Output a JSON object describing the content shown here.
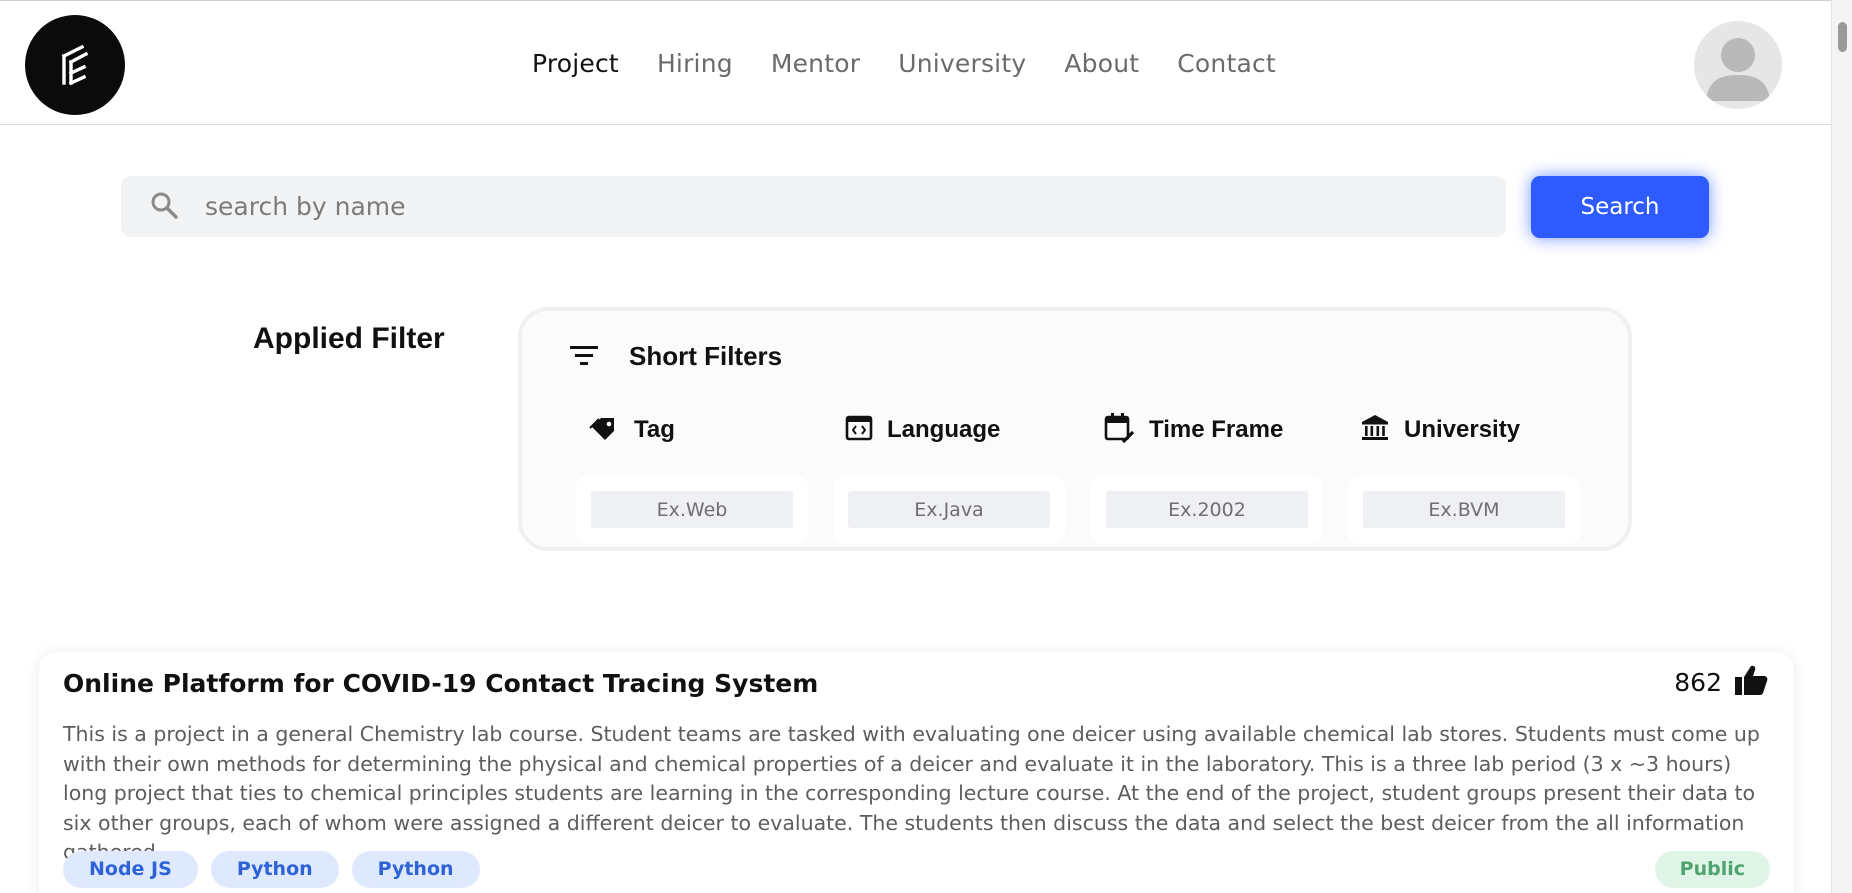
{
  "header": {
    "logo_icon": "brand-logo-icon",
    "nav": [
      {
        "label": "Project",
        "active": true
      },
      {
        "label": "Hiring",
        "active": false
      },
      {
        "label": "Mentor",
        "active": false
      },
      {
        "label": "University",
        "active": false
      },
      {
        "label": "About",
        "active": false
      },
      {
        "label": "Contact",
        "active": false
      }
    ],
    "avatar_icon": "user-avatar-icon"
  },
  "search": {
    "placeholder": "search by name",
    "value": "",
    "button_label": "Search",
    "icon": "search-icon"
  },
  "filters": {
    "applied_title": "Applied Filter",
    "panel_title": "Short Filters",
    "panel_icon": "filter-lines-icon",
    "fields": [
      {
        "label": "Tag",
        "icon": "tag-icon",
        "placeholder": "Ex.Web",
        "value": ""
      },
      {
        "label": "Language",
        "icon": "code-window-icon",
        "placeholder": "Ex.Java",
        "value": ""
      },
      {
        "label": "Time Frame",
        "icon": "calendar-edit-icon",
        "placeholder": "Ex.2002",
        "value": ""
      },
      {
        "label": "University",
        "icon": "institution-icon",
        "placeholder": "Ex.BVM",
        "value": ""
      }
    ]
  },
  "projects": [
    {
      "title": "Online Platform for COVID-19 Contact Tracing System",
      "likes": "862",
      "like_icon": "thumbs-up-icon",
      "description": "This is a project in a general Chemistry lab course. Student teams are tasked with evaluating one deicer using available chemical lab stores. Students must come up with their own methods for determining the physical and chemical properties of a deicer and evaluate it in the laboratory. This is a three lab period (3 x ~3 hours) long project that ties to chemical principles students are learning in the corresponding lecture course. At the end of the project, student groups present their data to six other groups, each of whom were assigned a different deicer to evaluate. The students then discuss the data and select the best deicer from the all information gathered.",
      "tags": [
        "Node JS",
        "Python",
        "Python"
      ],
      "visibility": "Public"
    }
  ],
  "colors": {
    "accent": "#2d5bff",
    "tag_bg": "#dfe9fd",
    "tag_text": "#2e63d8",
    "public_bg": "#e0f4e7",
    "public_text": "#4ea46f"
  }
}
